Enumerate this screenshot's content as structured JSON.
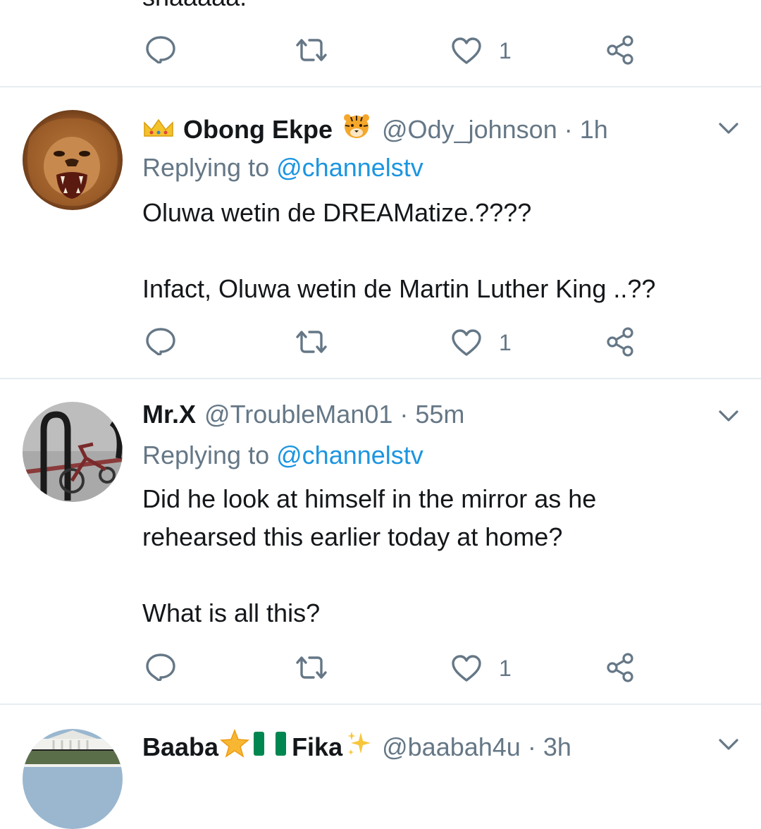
{
  "previous_tweet": {
    "text_fragment": "shaaaaa.",
    "like_count": "1"
  },
  "tweets": [
    {
      "name": "Obong Ekpe",
      "handle": "@Ody_johnson",
      "time": "· 1h",
      "replying_prefix": "Replying to",
      "replying_to": "@channelstv",
      "lines": [
        "Oluwa wetin de DREAMatize.????",
        "",
        "Infact, Oluwa wetin de Martin Luther King ..??"
      ],
      "like_count": "1",
      "name_prefix_icon": "crown-emoji",
      "name_suffix_icon": "tiger-face-emoji"
    },
    {
      "name": "Mr.X",
      "handle": "@TroubleMan01",
      "time": "· 55m",
      "replying_prefix": "Replying to",
      "replying_to": "@channelstv",
      "lines": [
        "Did he look at himself in the mirror as he",
        "rehearsed this earlier today at home?",
        "",
        "What is all this?"
      ],
      "like_count": "1"
    },
    {
      "name_part1": "Baaba",
      "name_part2": "Fika",
      "handle": "@baabah4u",
      "time": "· 3h",
      "icons": [
        "glowing-star-emoji",
        "nigeria-flag-emoji",
        "sparkles-emoji"
      ]
    }
  ],
  "colors": {
    "text_primary": "#14171a",
    "text_secondary": "#657786",
    "link": "#1b95e0",
    "divider": "#e6ecf0"
  }
}
